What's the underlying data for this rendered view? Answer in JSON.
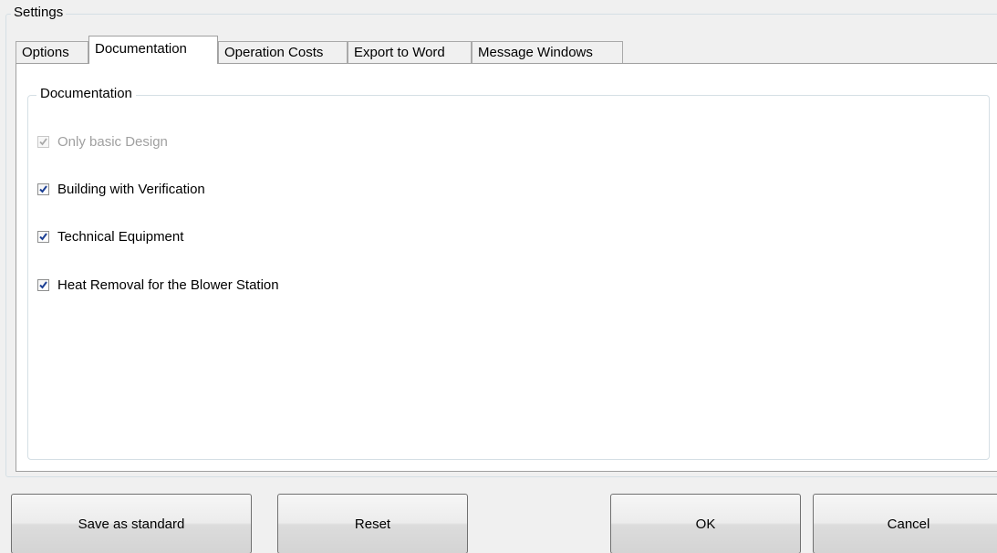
{
  "settings_title": "Settings",
  "tabs": [
    {
      "label": "Options",
      "active": false
    },
    {
      "label": "Documentation",
      "active": true
    },
    {
      "label": "Operation Costs",
      "active": false
    },
    {
      "label": "Export to Word",
      "active": false
    },
    {
      "label": "Message Windows",
      "active": false
    }
  ],
  "documentation": {
    "group_title": "Documentation",
    "options": [
      {
        "label": "Only basic Design",
        "checked": true,
        "enabled": false
      },
      {
        "label": "Building with Verification",
        "checked": true,
        "enabled": true
      },
      {
        "label": "Technical Equipment",
        "checked": true,
        "enabled": true
      },
      {
        "label": "Heat Removal for the Blower Station",
        "checked": true,
        "enabled": true
      }
    ]
  },
  "buttons": {
    "save_standard": "Save as standard",
    "reset": "Reset",
    "ok": "OK",
    "cancel": "Cancel"
  },
  "colors": {
    "check_mark": "#1c3f94",
    "check_mark_disabled": "#a8a8a8"
  }
}
